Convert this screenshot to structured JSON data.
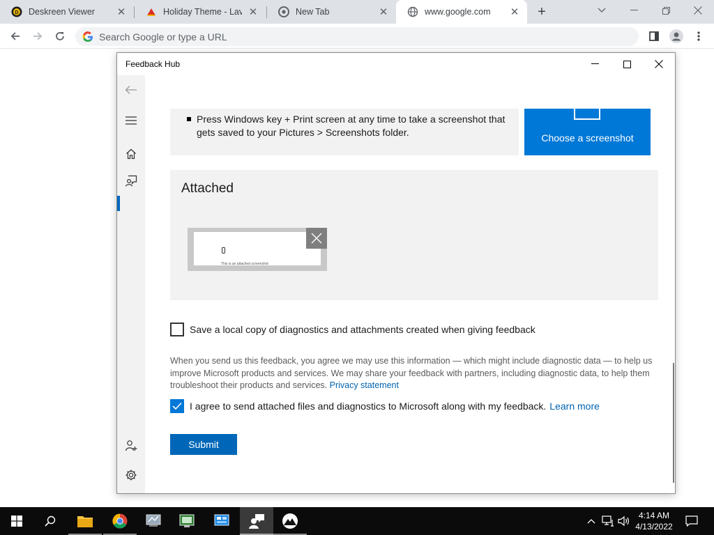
{
  "browser": {
    "tabs": [
      {
        "title": "Deskreen Viewer",
        "icon": "deskreen-icon"
      },
      {
        "title": "Holiday Theme - Lavasoft",
        "icon": "holiday-theme-icon"
      },
      {
        "title": "New Tab",
        "icon": "chrome-icon"
      },
      {
        "title": "www.google.com",
        "icon": "globe-icon",
        "active": true
      }
    ],
    "omnibox_placeholder": "Search Google or type a URL"
  },
  "feedback_hub": {
    "window_title": "Feedback Hub",
    "instruction": "Press Windows key + Print screen at any time to take a screenshot that gets saved to your Pictures > Screenshots folder.",
    "choose_screenshot_label": "Choose a screenshot",
    "attached_heading": "Attached",
    "thumbnail_caption": "This is an attached screenshot",
    "save_local_copy_label": "Save a local copy of diagnostics and attachments created when giving feedback",
    "save_local_copy_checked": false,
    "legal_text": "When you send us this feedback, you agree we may use this information — which might include diagnostic data — to help us improve Microsoft products and services. We may share your feedback with partners, including diagnostic data, to help them troubleshoot their products and services.",
    "privacy_link": "Privacy statement",
    "agree_label": "I agree to send attached files and diagnostics to Microsoft along with my feedback.",
    "agree_checked": true,
    "learn_more_link": "Learn more",
    "submit_label": "Submit",
    "accent_color": "#0078d7"
  },
  "taskbar": {
    "time": "4:14 AM",
    "date": "4/13/2022"
  }
}
